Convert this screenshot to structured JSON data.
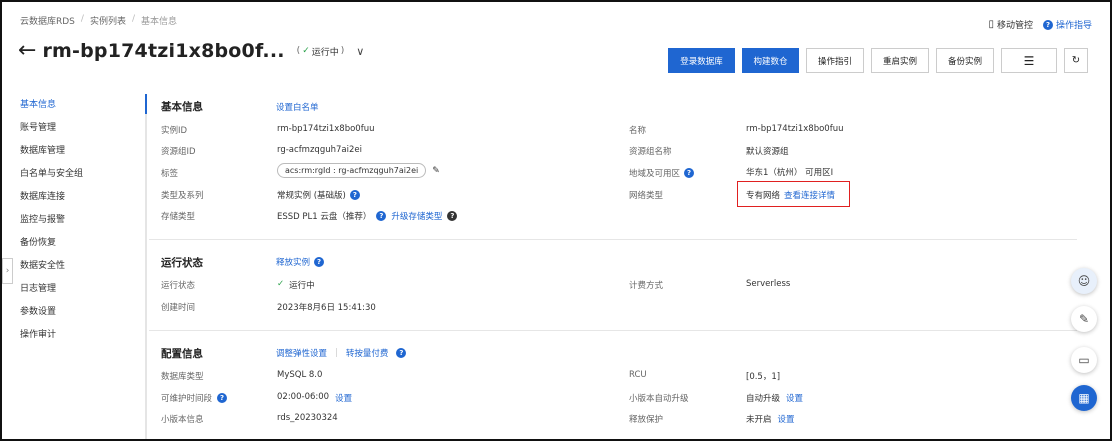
{
  "breadcrumb": [
    "云数据库RDS",
    "实例列表",
    "基本信息"
  ],
  "breadcrumb_sep": "/",
  "topright": {
    "mobile": "移动管控",
    "guide": "操作指导"
  },
  "header": {
    "back": "←",
    "title": "rm-bp174tzi1x8bo0f...",
    "status": "运行中",
    "chevron": "∨"
  },
  "actions": {
    "login": "登录数据库",
    "build": "构建数仓",
    "guide": "操作指引",
    "restart": "重启实例",
    "backup": "备份实例"
  },
  "sidebar": {
    "items": [
      {
        "label": "基本信息"
      },
      {
        "label": "账号管理"
      },
      {
        "label": "数据库管理"
      },
      {
        "label": "白名单与安全组"
      },
      {
        "label": "数据库连接"
      },
      {
        "label": "监控与报警"
      },
      {
        "label": "备份恢复"
      },
      {
        "label": "数据安全性"
      },
      {
        "label": "日志管理"
      },
      {
        "label": "参数设置"
      },
      {
        "label": "操作审计"
      }
    ]
  },
  "basic": {
    "title": "基本信息",
    "link": "设置白名单",
    "instance_id_label": "实例ID",
    "instance_id": "rm-bp174tzi1x8bo0fuu",
    "rg_label": "资源组ID",
    "rg": "rg-acfmzqguh7ai2ei",
    "tag_label": "标签",
    "tag": "acs:rm:rgId : rg-acfmzqguh7ai2ei",
    "type_label": "类型及系列",
    "type": "常规实例 (基础版)",
    "storage_label": "存储类型",
    "storage": "ESSD PL1 云盘（推荐）",
    "storage_link": "升级存储类型",
    "name_label": "名称",
    "name": "rm-bp174tzi1x8bo0fuu",
    "rgname_label": "资源组名称",
    "rgname": "默认资源组",
    "region_label": "地域及可用区",
    "region": "华东1（杭州） 可用区I",
    "net_label": "网络类型",
    "net": "专有网络",
    "net_link": "查看连接详情"
  },
  "running": {
    "title": "运行状态",
    "link": "释放实例",
    "status_label": "运行状态",
    "status": "运行中",
    "created_label": "创建时间",
    "created": "2023年8月6日 15:41:30",
    "billing_label": "计费方式",
    "billing": "Serverless"
  },
  "config": {
    "title": "配置信息",
    "link1": "调整弹性设置",
    "link2": "转按量付费",
    "db_label": "数据库类型",
    "db": "MySQL  8.0",
    "maint_label": "可维护时间段",
    "maint": "02:00-06:00",
    "maint_link": "设置",
    "minor_label": "小版本信息",
    "minor": "rds_20230324",
    "rcu_label": "RCU",
    "rcu": "[0.5，1]",
    "auto_label": "小版本自动升级",
    "auto": "自动升级",
    "auto_link": "设置",
    "protect_label": "释放保护",
    "protect": "未开启",
    "protect_link": "设置"
  },
  "icons": [
    "back-arrow-icon",
    "check-icon",
    "chevron-down-icon",
    "list-icon",
    "refresh-icon",
    "help-icon",
    "edit-icon",
    "mobile-icon",
    "guide-icon",
    "avatar-icon",
    "pen-icon",
    "chat-icon",
    "apps-icon"
  ],
  "colors": {
    "accent": "#1f66d1",
    "success": "#2aa14a",
    "highlight": "#e02020"
  }
}
